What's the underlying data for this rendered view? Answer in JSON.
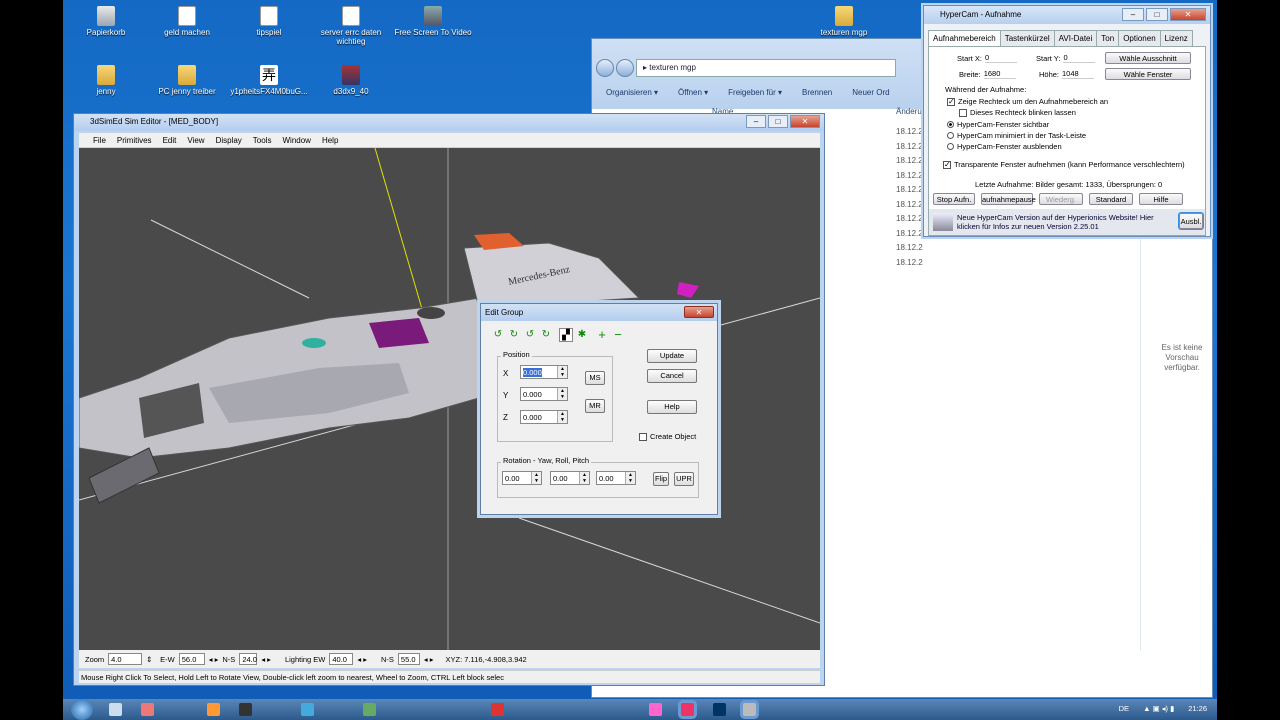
{
  "desktop": {
    "icons": [
      {
        "label": "Papierkorb"
      },
      {
        "label": "geld machen"
      },
      {
        "label": "tipspiel"
      },
      {
        "label": "server errc daten wichtieg"
      },
      {
        "label": "Free Screen To Video"
      },
      {
        "label": "texturen mgp"
      },
      {
        "label": "jenny"
      },
      {
        "label": "PC jenny treiber"
      },
      {
        "label": "y1pheitsFX4M0buG..."
      },
      {
        "label": "d3dx9_40"
      }
    ]
  },
  "explorer": {
    "address": "texturen mgp",
    "toolbar": [
      "Organisieren ▾",
      "Öffnen ▾",
      "Freigeben für ▾",
      "Brennen",
      "Neuer Ord"
    ],
    "col_name": "Name",
    "col_date": "Änderu",
    "dates": [
      "18.12.2",
      "18.12.2",
      "18.12.2",
      "18.12.2",
      "18.12.2",
      "18.12.2",
      "18.12.2",
      "18.12.2",
      "18.12.2",
      "18.12.2"
    ],
    "preview_text": "Es ist keine Vorschau verfügbar."
  },
  "hypercam": {
    "title": "HyperCam - Aufnahme",
    "tabs": [
      "Aufnahmebereich",
      "Tastenkürzel",
      "AVI-Datei",
      "Ton",
      "Optionen",
      "Lizenz"
    ],
    "start_x_label": "Start X:",
    "start_x": "0",
    "start_y_label": "Start Y:",
    "start_y": "0",
    "breite_label": "Breite:",
    "breite": "1680",
    "hoehe_label": "Höhe:",
    "hoehe": "1048",
    "btn_region": "Wähle Ausschnitt",
    "btn_window": "Wähle Fenster",
    "during_label": "Während der Aufnahme:",
    "opt1": "Zeige Rechteck um den Aufnahmebereich an",
    "opt2": "Dieses Rechteck blinken lassen",
    "opt3": "HyperCam-Fenster sichtbar",
    "opt4": "HyperCam minimiert in der Task-Leiste",
    "opt5": "HyperCam-Fenster ausblenden",
    "opt6": "Transparente Fenster aufnehmen (kann Performance verschlechtern)",
    "last_recording": "Letzte Aufnahme: Bilder gesamt: 1333, Übersprungen: 0",
    "buttons": [
      "Stop Aufn.",
      "aufnahmepause",
      "Wiederg.",
      "Standard",
      "Hilfe"
    ],
    "notice": "Neue HyperCam Version auf der Hyperionics Website! Hier klicken für Infos zur neuen Version 2.25.01",
    "notice_btn": "Ausbl."
  },
  "sim": {
    "title": "3dSimEd Sim Editor - [MED_BODY]",
    "menu": [
      "File",
      "Primitives",
      "Edit",
      "View",
      "Display",
      "Tools",
      "Window",
      "Help"
    ],
    "zoom_label": "Zoom",
    "zoom": "4.0",
    "ew_label": "E-W",
    "ew": "56.0",
    "ns_label": "N-S",
    "ns": "24.0",
    "light_label": "Lighting EW",
    "light_ew": "40.0",
    "light_ns_label": "N-S",
    "light_ns": "55.0",
    "xyz": "XYZ: 7.116,-4.908,3.942",
    "hint": "Mouse Right Click To Select, Hold Left to Rotate View, Double-click left  zoom to nearest, Wheel to Zoom, CTRL Left block selec",
    "car_text": "Mercedes-Benz"
  },
  "dialog": {
    "title": "Edit Group",
    "position_label": "Position",
    "x_label": "X",
    "x": "0.000",
    "y_label": "Y",
    "y": "0.000",
    "z_label": "Z",
    "z": "0.000",
    "ms": "MS",
    "mr": "MR",
    "update": "Update",
    "cancel": "Cancel",
    "help": "Help",
    "create_object": "Create Object",
    "rotation_label": "Rotation - Yaw, Roll, Pitch",
    "yaw": "0.00",
    "roll": "0.00",
    "pitch": "0.00",
    "flip": "Flip",
    "upr": "UPR"
  },
  "taskbar": {
    "lang": "DE",
    "time": "21:26"
  }
}
